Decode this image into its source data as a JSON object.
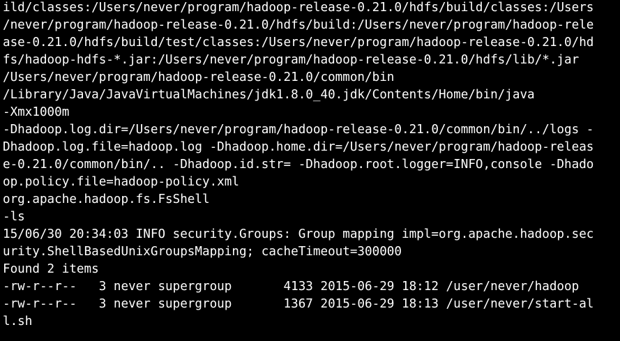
{
  "terminal": {
    "colors": {
      "background": "#000000",
      "foreground": "#ffffff"
    },
    "lines": [
      "ild/classes:/Users/never/program/hadoop-release-0.21.0/hdfs/build/classes:/Users",
      "/never/program/hadoop-release-0.21.0/hdfs/build:/Users/never/program/hadoop-rele",
      "ase-0.21.0/hdfs/build/test/classes:/Users/never/program/hadoop-release-0.21.0/hd",
      "fs/hadoop-hdfs-*.jar:/Users/never/program/hadoop-release-0.21.0/hdfs/lib/*.jar",
      "/Users/never/program/hadoop-release-0.21.0/common/bin",
      "/Library/Java/JavaVirtualMachines/jdk1.8.0_40.jdk/Contents/Home/bin/java",
      "-Xmx1000m",
      "-Dhadoop.log.dir=/Users/never/program/hadoop-release-0.21.0/common/bin/../logs -",
      "Dhadoop.log.file=hadoop.log -Dhadoop.home.dir=/Users/never/program/hadoop-releas",
      "e-0.21.0/common/bin/.. -Dhadoop.id.str= -Dhadoop.root.logger=INFO,console -Dhado",
      "op.policy.file=hadoop-policy.xml",
      "org.apache.hadoop.fs.FsShell",
      "-ls",
      "15/06/30 20:34:03 INFO security.Groups: Group mapping impl=org.apache.hadoop.sec",
      "urity.ShellBasedUnixGroupsMapping; cacheTimeout=300000",
      "Found 2 items",
      "-rw-r--r--   3 never supergroup       4133 2015-06-29 18:12 /user/never/hadoop",
      "-rw-r--r--   3 never supergroup       1367 2015-06-29 18:13 /user/never/start-al",
      "l.sh"
    ]
  }
}
